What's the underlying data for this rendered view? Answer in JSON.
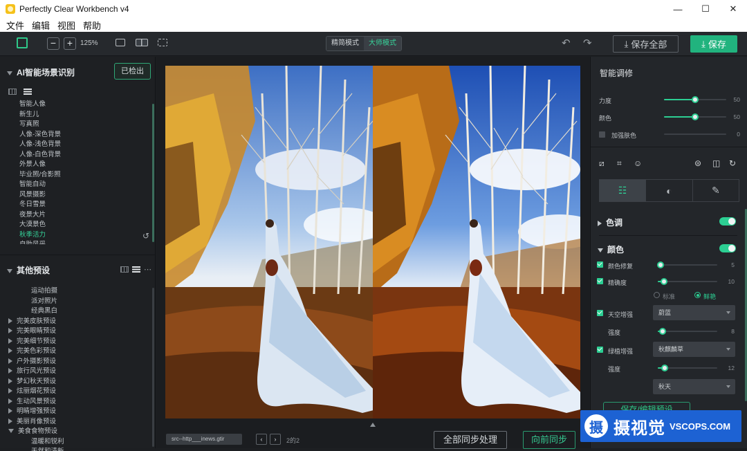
{
  "window": {
    "title": "Perfectly Clear Workbench v4",
    "controls": [
      "—",
      "☐",
      "✕"
    ]
  },
  "menu": [
    "文件",
    "编辑",
    "视图",
    "帮助"
  ],
  "toolbar": {
    "zoom_out": "−",
    "zoom_in": "+",
    "zoom": "125%",
    "modes": [
      "精简模式",
      "大师模式"
    ],
    "save_all": "保存全部",
    "save": "保存",
    "undo": "↶",
    "redo": "↷"
  },
  "left_panel": {
    "scene_title": "AI智能场景识别",
    "detected_button": "已检出",
    "scenes": [
      "智能人像",
      "新生儿",
      "写真照",
      "人像-深色背景",
      "人像-浅色背景",
      "人像-白色背景",
      "外景人像",
      "毕业照/合影照",
      "智能自动",
      "风景摄影",
      "冬日雪景",
      "夜景大片",
      "大漠景色",
      "秋季活力",
      "自助风采"
    ],
    "active_scene": "秋季活力",
    "presets_title": "其他预设",
    "preset_subitems": [
      "运动拍摄",
      "派对照片",
      "经典黑白"
    ],
    "presets": [
      "完美皮肤预设",
      "完美眼睛预设",
      "完美细节预设",
      "完美色彩预设",
      "户外摄影预设",
      "旅行风光预设",
      "梦幻秋天预设",
      "炫丽烟花预设",
      "生动风景预设",
      "明睛增强预设",
      "美丽肖像预设",
      "美食食物预设"
    ],
    "expanded_preset_children": [
      "温暖和锐利",
      "天然和清新"
    ]
  },
  "canvas": {
    "source_file": "src--http___inews.gtir",
    "prev": "‹",
    "next": "›",
    "page_info": "2的2",
    "sync_all": "全部同步处理",
    "sync_forward": "向前同步"
  },
  "right_panel": {
    "smart_title": "智能调修",
    "smart_sliders": [
      {
        "label": "力度",
        "value": 50
      },
      {
        "label": "颜色",
        "value": 50
      },
      {
        "label": "加强肤色",
        "value": 0
      }
    ],
    "tool_icons": [
      "curve-icon",
      "crop-icon",
      "face-icon",
      "flip-v-icon",
      "compare-icon",
      "rotate-icon"
    ],
    "tabs": [
      "adjust-tab",
      "color-wheel-tab",
      "palette-tab"
    ],
    "tone_group": "色调",
    "color_group": "颜色",
    "color_fix": {
      "label": "颜色修复",
      "value": 5
    },
    "vibrance": {
      "label": "精确度",
      "value": 10
    },
    "radio_options": [
      "标准",
      "鲜艳"
    ],
    "sky": {
      "label": "天空增强",
      "select": "蔚蓝",
      "strength_label": "强度",
      "strength": 8
    },
    "green": {
      "label": "绿植增强",
      "select": "秋麒麟草",
      "strength_label": "强度",
      "strength": 12
    },
    "season_select": "秋天",
    "save_preset": "保存/编辑预设"
  },
  "watermark": {
    "logo": "摄",
    "cn": "摄视觉",
    "en": "VSCOPS.COM"
  },
  "colors": {
    "accent": "#2ccf93",
    "save_bg": "#21b37e"
  }
}
